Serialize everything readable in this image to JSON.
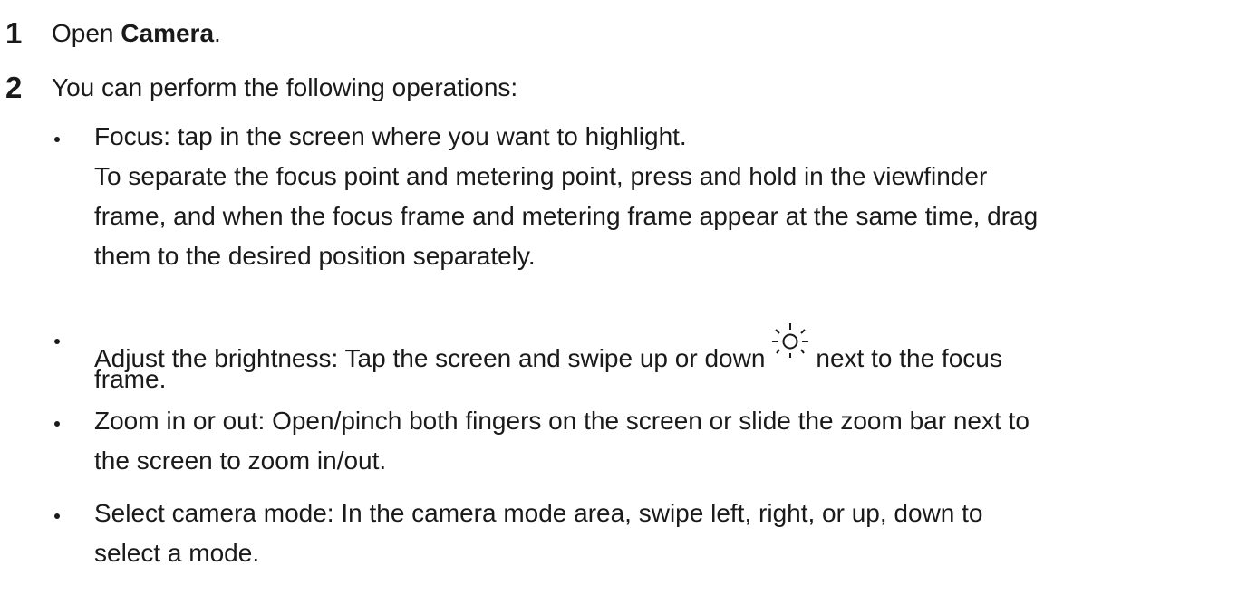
{
  "steps": [
    {
      "number": "1",
      "prefix": "Open ",
      "bold": "Camera",
      "suffix": "."
    },
    {
      "number": "2",
      "text": "You can perform the following operations:"
    }
  ],
  "bullets": [
    {
      "lines": [
        "Focus: tap in the screen where you want to highlight.",
        "To separate the focus point and metering point, press and hold in the viewfinder",
        "frame, and when the focus frame and metering frame appear at the same time, drag",
        "them to the desired position separately."
      ]
    },
    {
      "line1_before": "Adjust the brightness: Tap the screen and swipe up or down",
      "line1_after": "next to the focus",
      "line2": "frame.",
      "icon": "brightness-sun-icon"
    },
    {
      "lines": [
        "Zoom in or out: Open/pinch both fingers on the screen or slide the zoom bar next to",
        "the screen to zoom in/out."
      ]
    },
    {
      "lines": [
        "Select camera mode: In the camera mode area, swipe left, right, or up, down to",
        "select a mode."
      ]
    }
  ]
}
